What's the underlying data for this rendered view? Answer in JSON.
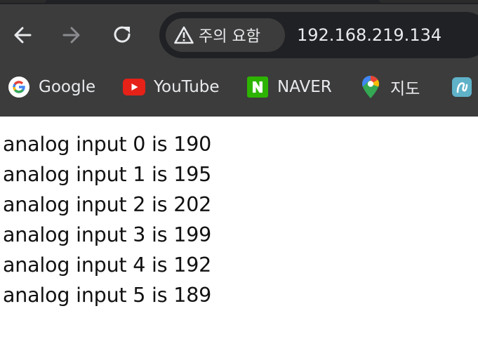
{
  "toolbar": {
    "back_icon": "back-arrow-icon",
    "forward_icon": "forward-arrow-icon",
    "reload_icon": "reload-icon"
  },
  "omnibox": {
    "security_icon": "warning-triangle-icon",
    "security_label": "주의 요함",
    "url": "192.168.219.134"
  },
  "bookmarks": [
    {
      "label": "Google",
      "icon": "google-icon"
    },
    {
      "label": "YouTube",
      "icon": "youtube-icon"
    },
    {
      "label": "NAVER",
      "icon": "naver-icon"
    },
    {
      "label": "지도",
      "icon": "maps-pin-icon"
    },
    {
      "label": "",
      "icon": "extra-bookmark-icon"
    }
  ],
  "colors": {
    "chrome_bg": "#3c3c3c",
    "omnibox_bg": "#202124",
    "chrome_text": "#e8eaed",
    "page_bg": "#ffffff",
    "page_text": "#111111"
  },
  "page": {
    "lines": [
      "analog input 0 is 190",
      "analog input 1 is 195",
      "analog input 2 is 202",
      "analog input 3 is 199",
      "analog input 4 is 192",
      "analog input 5 is 189"
    ]
  }
}
